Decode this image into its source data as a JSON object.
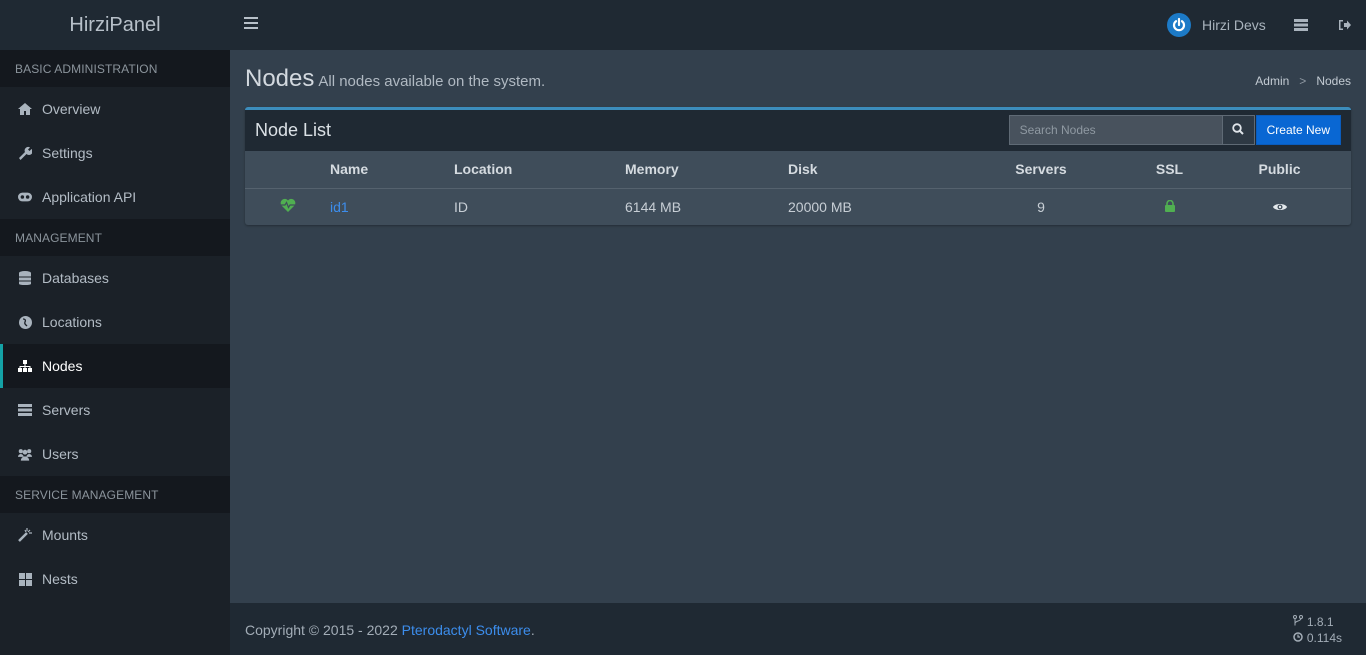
{
  "brand": {
    "name": "HirziPanel"
  },
  "topbar": {
    "menu_toggle_icon": "bars-icon",
    "user": {
      "name": "Hirzi Devs",
      "avatar_icon": "power-icon",
      "avatar_color": "#1c7ac7"
    },
    "icons": [
      "server-list-icon",
      "sign-out-icon"
    ]
  },
  "sidebar": {
    "sections": [
      {
        "header": "BASIC ADMINISTRATION",
        "items": [
          {
            "label": "Overview",
            "icon": "home-icon"
          },
          {
            "label": "Settings",
            "icon": "wrench-icon"
          },
          {
            "label": "Application API",
            "icon": "gamepad-icon"
          }
        ]
      },
      {
        "header": "MANAGEMENT",
        "items": [
          {
            "label": "Databases",
            "icon": "database-icon"
          },
          {
            "label": "Locations",
            "icon": "globe-icon"
          },
          {
            "label": "Nodes",
            "icon": "sitemap-icon",
            "active": true
          },
          {
            "label": "Servers",
            "icon": "server-icon"
          },
          {
            "label": "Users",
            "icon": "users-icon"
          }
        ]
      },
      {
        "header": "SERVICE MANAGEMENT",
        "items": [
          {
            "label": "Mounts",
            "icon": "magic-icon"
          },
          {
            "label": "Nests",
            "icon": "th-large-icon"
          }
        ]
      }
    ],
    "active_color": "#14a2a6"
  },
  "page": {
    "title": "Nodes",
    "subtitle": "All nodes available on the system.",
    "breadcrumb": [
      "Admin",
      "Nodes"
    ],
    "breadcrumb_separator": ">"
  },
  "node_list": {
    "title": "Node List",
    "search_placeholder": "Search Nodes",
    "search_value": "",
    "create_label": "Create New",
    "columns": [
      "",
      "Name",
      "Location",
      "Memory",
      "Disk",
      "Servers",
      "SSL",
      "Public"
    ],
    "rows": [
      {
        "status_icon": "heartbeat-icon",
        "status_color": "#50af51",
        "name": "id1",
        "location": "ID",
        "memory": "6144 MB",
        "disk": "20000 MB",
        "servers": "9",
        "ssl_icon": "lock-icon",
        "ssl_color": "#50af51",
        "public_icon": "eye-icon"
      }
    ]
  },
  "footer": {
    "copyright": "Copyright © 2015 - 2022 ",
    "link": "Pterodactyl Software",
    "suffix": ".",
    "version": "1.8.1",
    "render_time": "0.114s"
  }
}
